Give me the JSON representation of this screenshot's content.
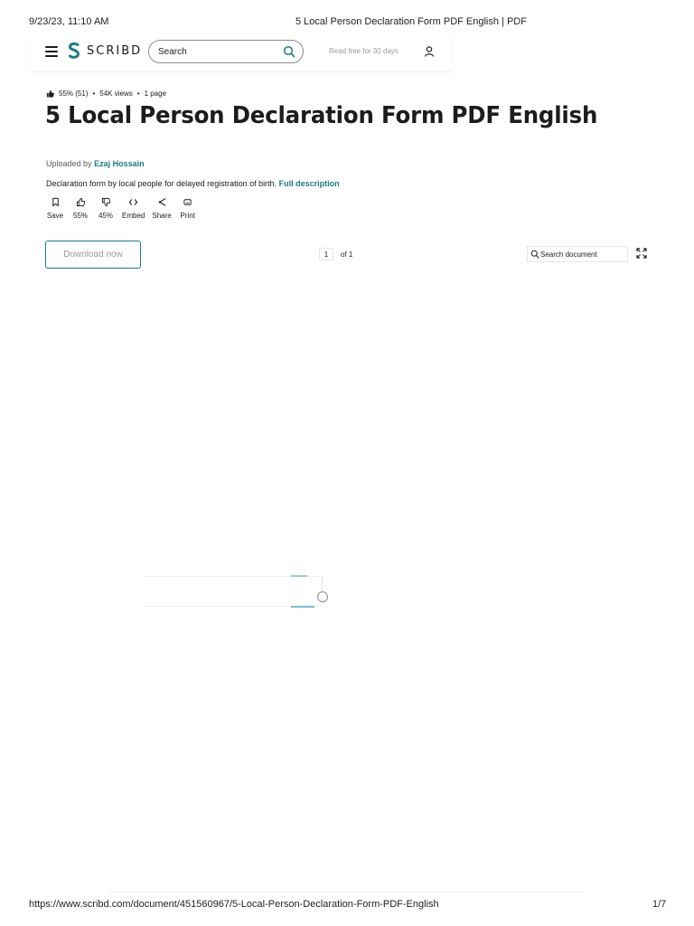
{
  "print": {
    "datetime": "9/23/23, 11:10 AM",
    "page_title": "5 Local Person Declaration Form PDF English | PDF",
    "url": "https://www.scribd.com/document/451560967/5-Local-Person-Declaration-Form-PDF-English",
    "page_count": "1/7"
  },
  "nav": {
    "brand": "SCRIBD",
    "search_placeholder": "Search",
    "read_free": "Read free for 30 days",
    "brand_color": "#1e7b85"
  },
  "doc": {
    "rating": "55% (51)",
    "views": "54K views",
    "pages": "1 page",
    "title": "5 Local Person Declaration Form PDF English",
    "uploaded_prefix": "Uploaded by",
    "uploader": "Ezaj Hossain",
    "description": "Declaration form by local people for delayed registration of birth.",
    "full_description": "Full description"
  },
  "actions": {
    "save": "Save",
    "like": "55%",
    "dislike": "45%",
    "embed": "Embed",
    "share": "Share",
    "print": "Print"
  },
  "toolbar": {
    "download": "Download now",
    "page_current": "1",
    "page_of": "of 1",
    "search_placeholder": "Search document"
  }
}
